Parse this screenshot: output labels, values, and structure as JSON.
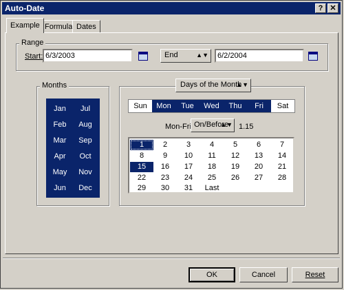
{
  "window": {
    "title": "Auto-Date",
    "help_btn": "?",
    "close_btn": "✕"
  },
  "tabs": [
    {
      "label": "Example"
    },
    {
      "label": "Formula"
    },
    {
      "label": "Dates"
    }
  ],
  "range": {
    "legend": "Range",
    "start_label": "Start:",
    "start_value": "6/3/2003",
    "end_select": "End",
    "end_value": "6/2/2004"
  },
  "months": {
    "legend": "Months",
    "items": [
      "Jan",
      "Jul",
      "Feb",
      "Aug",
      "Mar",
      "Sep",
      "Apr",
      "Oct",
      "May",
      "Nov",
      "Jun",
      "Dec"
    ]
  },
  "days_mode": "Days of the Month",
  "weekdays": [
    {
      "label": "Sun",
      "selected": false
    },
    {
      "label": "Mon",
      "selected": true
    },
    {
      "label": "Tue",
      "selected": true
    },
    {
      "label": "Wed",
      "selected": true
    },
    {
      "label": "Thu",
      "selected": true
    },
    {
      "label": "Fri",
      "selected": true
    },
    {
      "label": "Sat",
      "selected": false
    }
  ],
  "monfri": {
    "label": "Mon-Fri",
    "select": "On/Before",
    "value": "1.15"
  },
  "days": [
    "1",
    "2",
    "3",
    "4",
    "5",
    "6",
    "7",
    "8",
    "9",
    "10",
    "11",
    "12",
    "13",
    "14",
    "15",
    "16",
    "17",
    "18",
    "19",
    "20",
    "21",
    "22",
    "23",
    "24",
    "25",
    "26",
    "27",
    "28",
    "29",
    "30",
    "31",
    "Last"
  ],
  "selected_days": [
    "1",
    "15"
  ],
  "buttons": {
    "ok": "OK",
    "cancel": "Cancel",
    "reset": "Reset"
  }
}
